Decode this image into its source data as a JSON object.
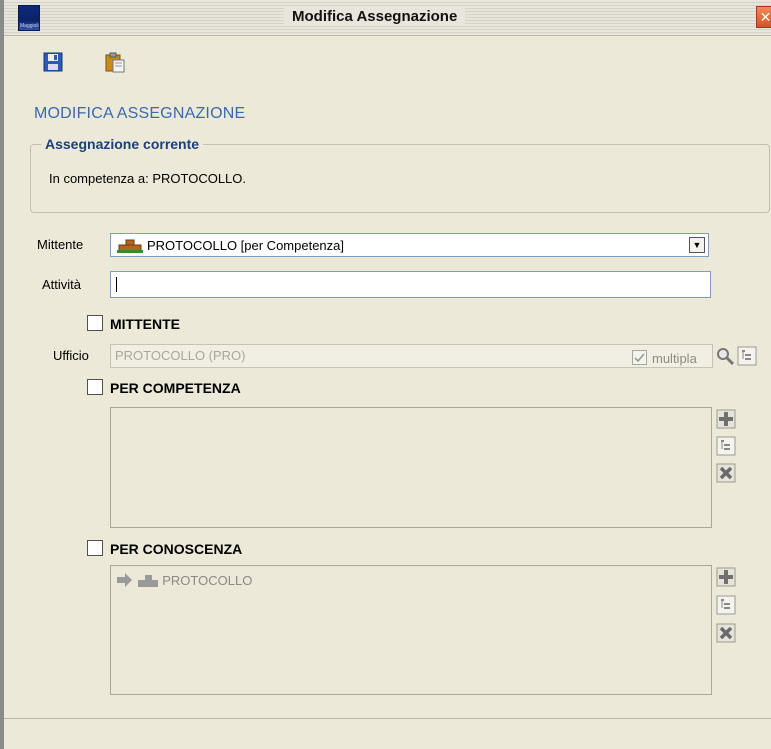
{
  "window": {
    "title": "Modifica Assegnazione",
    "logo_text": "Maggioli"
  },
  "toolbar": {
    "save_icon": "floppy-disk-icon",
    "paste_icon": "clipboard-paste-icon"
  },
  "header": {
    "section_title": "MODIFICA ASSEGNAZIONE"
  },
  "current_assignment": {
    "legend": "Assegnazione corrente",
    "text": "In competenza a: PROTOCOLLO."
  },
  "form": {
    "mittente_label": "Mittente",
    "mittente_value": "PROTOCOLLO [per Competenza]",
    "attivita_label": "Attività",
    "attivita_value": "",
    "mittente_checkbox_label": "MITTENTE",
    "ufficio_label": "Ufficio",
    "ufficio_value": "PROTOCOLLO (PRO)",
    "competenza_checkbox_label": "PER COMPETENZA",
    "multipla_label": "multipla",
    "multipla_checked": true,
    "conoscenza_checkbox_label": "PER CONOSCENZA",
    "competenza_items": [],
    "conoscenza_items": [
      "PROTOCOLLO"
    ]
  },
  "colors": {
    "section_title": "#3a69b0",
    "legend": "#1d3f7a",
    "background": "#ece9d8"
  }
}
